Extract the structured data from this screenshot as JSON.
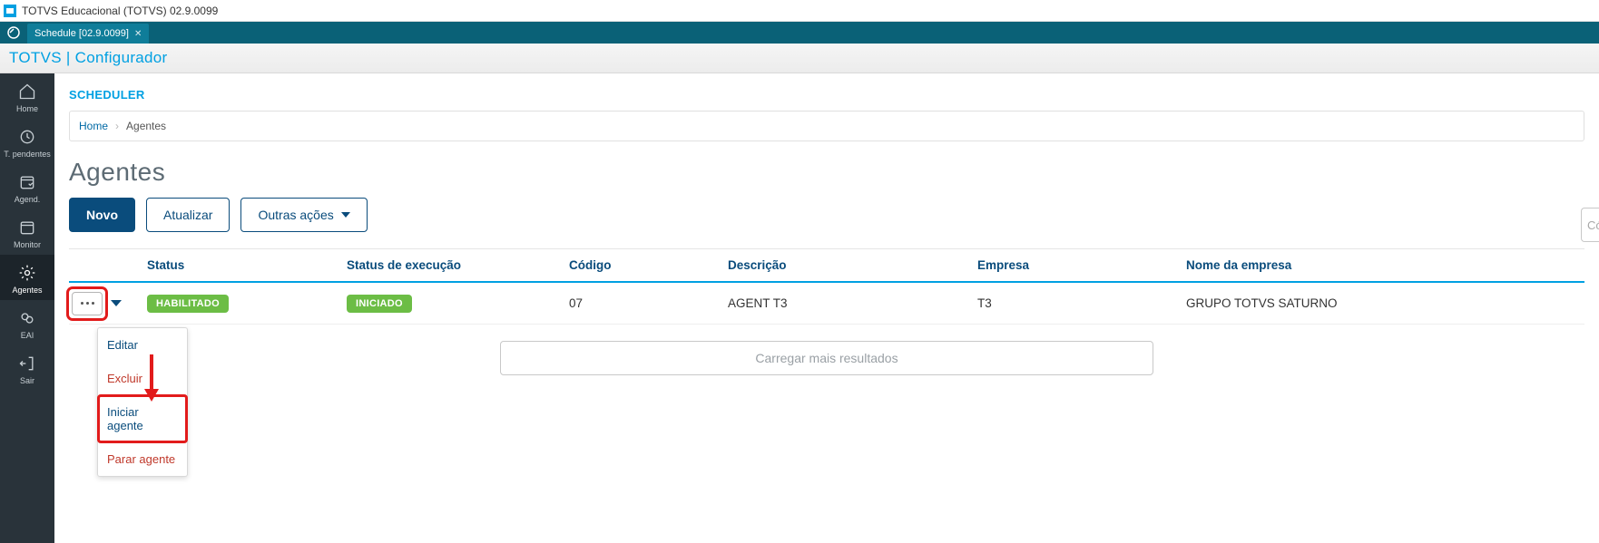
{
  "window": {
    "title": "TOTVS Educacional (TOTVS) 02.9.0099"
  },
  "tab": {
    "label": "Schedule [02.9.0099]"
  },
  "subheader": {
    "text": "TOTVS | Configurador"
  },
  "sidebar": {
    "items": [
      {
        "label": "Home"
      },
      {
        "label": "T. pendentes"
      },
      {
        "label": "Agend."
      },
      {
        "label": "Monitor"
      },
      {
        "label": "Agentes"
      },
      {
        "label": "EAI"
      },
      {
        "label": "Sair"
      }
    ]
  },
  "section": {
    "title": "SCHEDULER"
  },
  "breadcrumb": {
    "home": "Home",
    "current": "Agentes"
  },
  "page": {
    "title": "Agentes"
  },
  "buttons": {
    "novo": "Novo",
    "atualizar": "Atualizar",
    "outras": "Outras ações"
  },
  "search": {
    "placeholder": "Có"
  },
  "table": {
    "headers": {
      "status": "Status",
      "exec": "Status de execução",
      "code": "Código",
      "desc": "Descrição",
      "emp": "Empresa",
      "empname": "Nome da empresa"
    },
    "rows": [
      {
        "status": "HABILITADO",
        "exec": "INICIADO",
        "code": "07",
        "desc": "AGENT T3",
        "emp": "T3",
        "empname": "GRUPO TOTVS SATURNO"
      }
    ]
  },
  "loadmore": {
    "label": "Carregar mais resultados"
  },
  "menu": {
    "editar": "Editar",
    "excluir": "Excluir",
    "iniciar": "Iniciar agente",
    "parar": "Parar agente"
  }
}
